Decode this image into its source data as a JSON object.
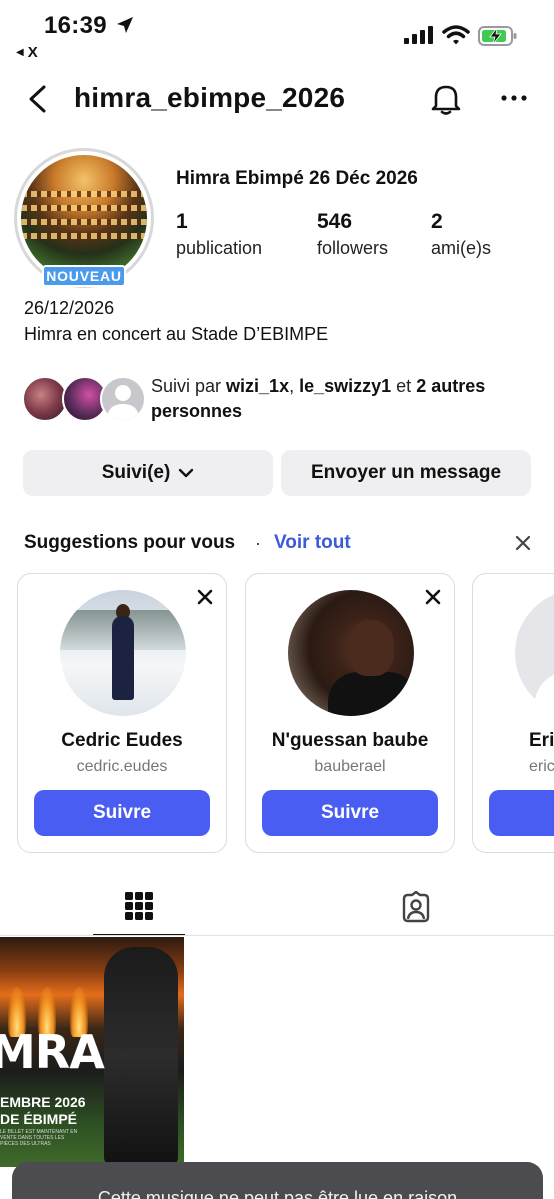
{
  "status_bar": {
    "time": "16:39",
    "back_app_label": "X"
  },
  "header": {
    "username": "himra_ebimpe_2026"
  },
  "profile": {
    "new_badge": "NOUVEAU",
    "full_name": "Himra Ebimpé 26 Déc 2026",
    "stats": [
      {
        "value": "1",
        "label": "publication"
      },
      {
        "value": "546",
        "label": "followers"
      },
      {
        "value": "2",
        "label": "ami(e)s"
      }
    ],
    "bio_date": "26/12/2026",
    "bio_text": "Himra en concert au Stade D’EBIMPE",
    "followed_by": {
      "prefix": "Suivi par ",
      "user1": "wizi_1x",
      "sep": ", ",
      "user2": "le_swizzy1",
      "conj": " et ",
      "others": "2 autres personnes"
    }
  },
  "actions": {
    "following_label": "Suivi(e)",
    "message_label": "Envoyer un message"
  },
  "suggestions": {
    "title": "Suggestions pour vous",
    "see_all": "Voir tout",
    "cards": [
      {
        "name": "Cedric Eudes",
        "handle": "cedric.eudes",
        "button": "Suivre"
      },
      {
        "name": "N'guessan baube",
        "handle": "bauberael",
        "button": "Suivre"
      },
      {
        "name": "Eri",
        "handle": "eric",
        "button": "S"
      }
    ]
  },
  "post": {
    "logo": "MRA",
    "line1": "EMBRE 2026",
    "line2": "DE ÉBIMPÉ",
    "line3": "LE BILLET EST MAINTENANT EN VENTE DANS TOUTES LES PIÈCES DES ULTRAS"
  },
  "toast": {
    "text": "Cette musique ne peut pas être lue en raison"
  }
}
